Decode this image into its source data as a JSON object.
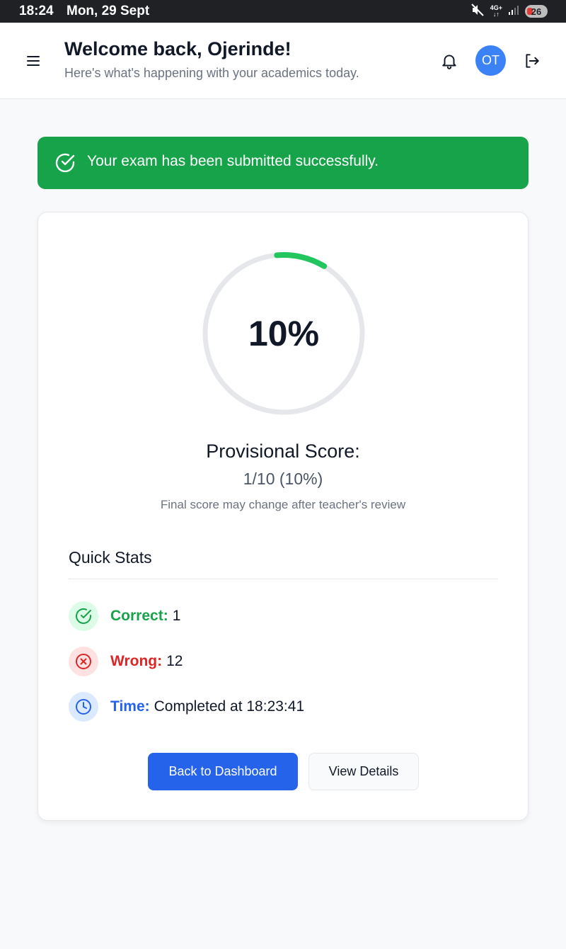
{
  "status_bar": {
    "time": "18:24",
    "date": "Mon, 29 Sept",
    "network_top": "4G+",
    "network_bottom": "↓↑",
    "battery": "26",
    "icons": [
      "mute-icon",
      "signal-icon",
      "battery-icon"
    ]
  },
  "header": {
    "title": "Welcome back, Ojerinde!",
    "subtitle": "Here's what's happening with your academics today.",
    "avatar_initials": "OT",
    "icons": [
      "menu-icon",
      "bell-icon",
      "logout-icon"
    ]
  },
  "alert": {
    "message": "Your exam has been submitted successfully.",
    "color": "#16a34a",
    "icon": "check-circle-icon"
  },
  "score": {
    "percent_text": "10%",
    "progress_fraction": 0.1,
    "label": "Provisional Score:",
    "value": "1/10 (10%)",
    "note": "Final score may change after teacher's review",
    "ring_color": "#22c55e",
    "track_color": "#e5e7eb"
  },
  "quick_stats": {
    "title": "Quick Stats",
    "correct": {
      "label": "Correct:",
      "value": "1",
      "icon": "check-circle-icon",
      "color": "#16a34a"
    },
    "wrong": {
      "label": "Wrong:",
      "value": "12",
      "icon": "x-circle-icon",
      "color": "#dc2626"
    },
    "time": {
      "label": "Time:",
      "value": "Completed at 18:23:41",
      "icon": "clock-icon",
      "color": "#2563eb"
    }
  },
  "actions": {
    "primary": "Back to Dashboard",
    "secondary": "View Details"
  }
}
